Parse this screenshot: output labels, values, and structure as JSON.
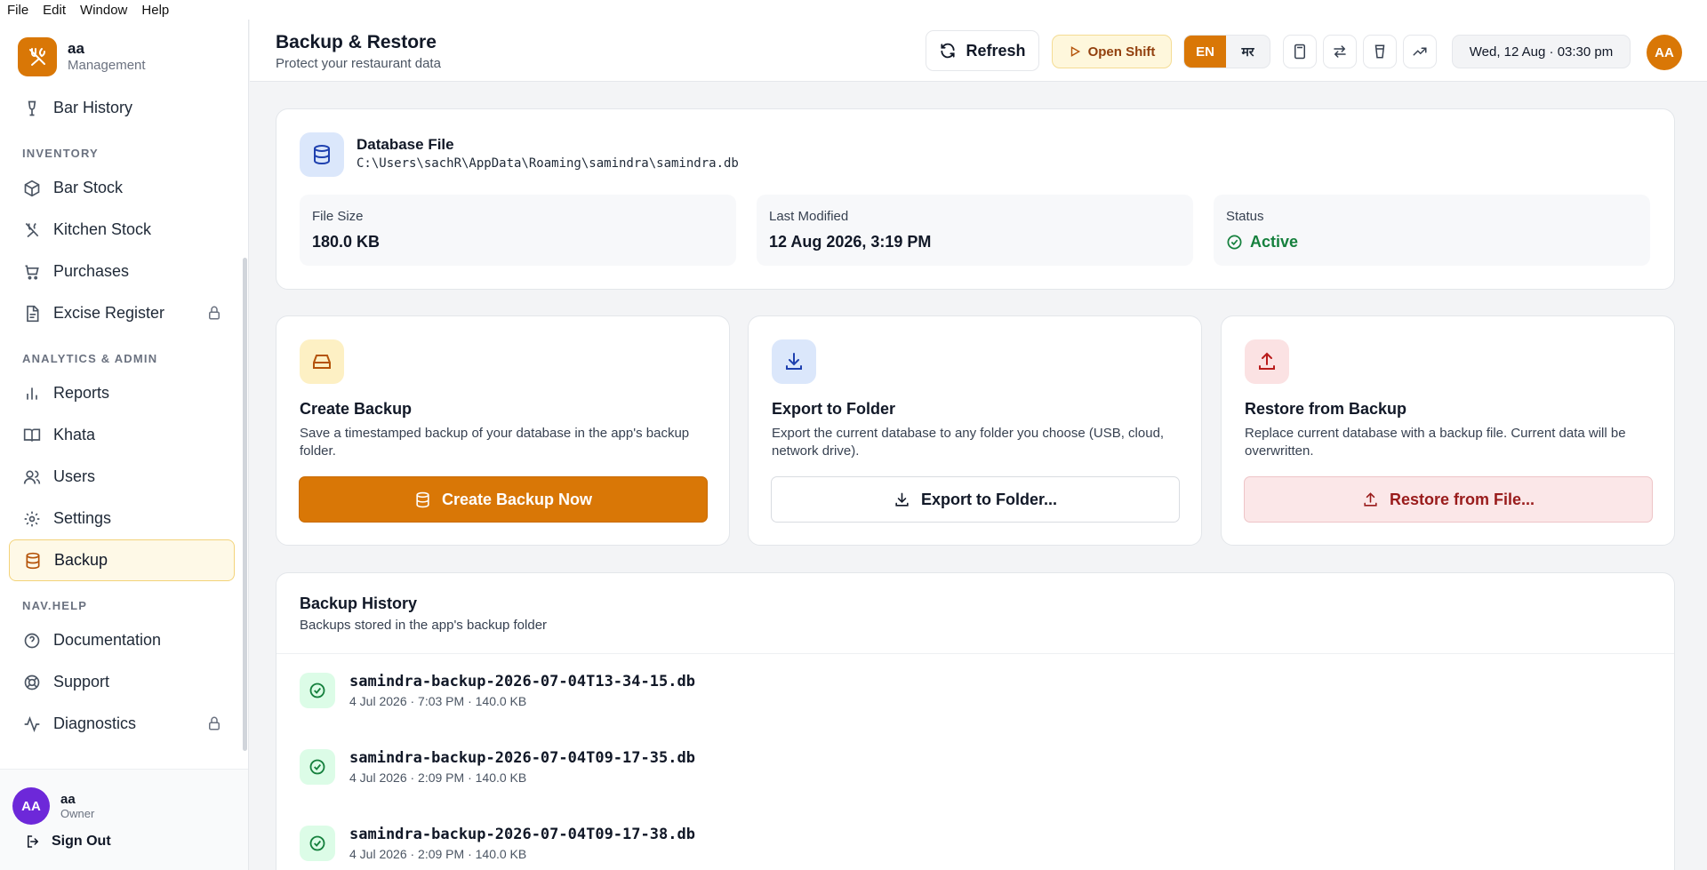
{
  "menubar": [
    "File",
    "Edit",
    "Window",
    "Help"
  ],
  "brand": {
    "name": "aa",
    "subtitle": "Management",
    "icon": "fork-knife-icon",
    "color": "#d97706"
  },
  "sidebar": {
    "items": [
      {
        "label": "Bar History",
        "icon": "bar-history-icon"
      },
      {
        "section": "INVENTORY"
      },
      {
        "label": "Bar Stock",
        "icon": "box-icon"
      },
      {
        "label": "Kitchen Stock",
        "icon": "utensils-icon"
      },
      {
        "label": "Purchases",
        "icon": "cart-icon"
      },
      {
        "label": "Excise Register",
        "icon": "file-icon",
        "locked": true
      },
      {
        "section": "ANALYTICS & ADMIN"
      },
      {
        "label": "Reports",
        "icon": "bar-chart-icon"
      },
      {
        "label": "Khata",
        "icon": "book-icon"
      },
      {
        "label": "Users",
        "icon": "users-icon"
      },
      {
        "label": "Settings",
        "icon": "gear-icon"
      },
      {
        "label": "Backup",
        "icon": "database-icon",
        "active": true
      },
      {
        "section": "NAV.HELP"
      },
      {
        "label": "Documentation",
        "icon": "help-circle-icon"
      },
      {
        "label": "Support",
        "icon": "lifebuoy-icon"
      },
      {
        "label": "Diagnostics",
        "icon": "activity-icon",
        "locked": true
      }
    ],
    "user": {
      "initials": "AA",
      "name": "aa",
      "role": "Owner"
    },
    "signout_label": "Sign Out"
  },
  "header": {
    "title": "Backup & Restore",
    "subtitle": "Protect your restaurant data",
    "refresh_label": "Refresh",
    "open_shift_label": "Open Shift",
    "lang_en": "EN",
    "lang_mr": "मर",
    "icons": [
      "calculator-icon",
      "swap-icon",
      "glass-icon",
      "trending-up-icon"
    ],
    "datetime": "Wed, 12 Aug · 03:30 pm",
    "avatar_initials": "AA"
  },
  "database": {
    "title": "Database File",
    "path": "C:\\Users\\sachR\\AppData\\Roaming\\samindra\\samindra.db",
    "stats": [
      {
        "label": "File Size",
        "value": "180.0 KB"
      },
      {
        "label": "Last Modified",
        "value": "12 Aug 2026, 3:19 PM"
      },
      {
        "label": "Status",
        "value": "Active"
      }
    ]
  },
  "actions": [
    {
      "title": "Create Backup",
      "desc": "Save a timestamped backup of your database in the app's backup folder.",
      "button": "Create Backup Now",
      "icon": "drive-icon"
    },
    {
      "title": "Export to Folder",
      "desc": "Export the current database to any folder you choose (USB, cloud, network drive).",
      "button": "Export to Folder...",
      "icon": "download-icon"
    },
    {
      "title": "Restore from Backup",
      "desc": "Replace current database with a backup file. Current data will be overwritten.",
      "button": "Restore from File...",
      "icon": "upload-icon"
    }
  ],
  "history": {
    "title": "Backup History",
    "subtitle": "Backups stored in the app's backup folder",
    "rows": [
      {
        "name": "samindra-backup-2026-07-04T13-34-15.db",
        "meta": "4 Jul 2026 · 7:03 PM · 140.0 KB"
      },
      {
        "name": "samindra-backup-2026-07-04T09-17-35.db",
        "meta": "4 Jul 2026 · 2:09 PM · 140.0 KB"
      },
      {
        "name": "samindra-backup-2026-07-04T09-17-38.db",
        "meta": "4 Jul 2026 · 2:09 PM · 140.0 KB"
      }
    ]
  }
}
